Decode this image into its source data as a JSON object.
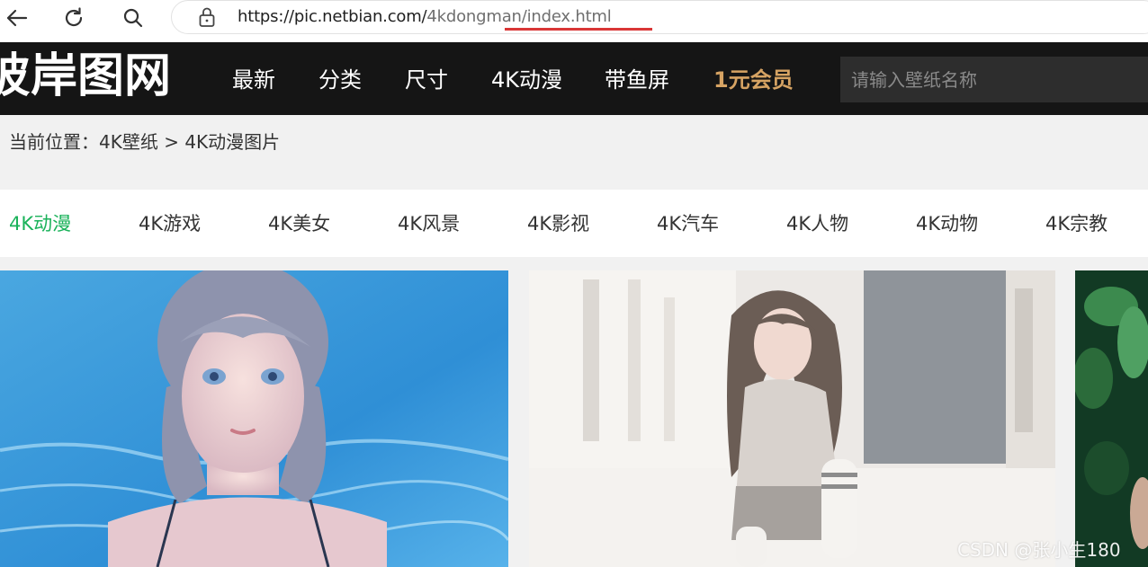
{
  "browser": {
    "url_host": "https://pic.netbian.com/",
    "url_path": "4kdongman/index.html"
  },
  "site": {
    "logo_text": "彼岸图网",
    "nav": [
      "最新",
      "分类",
      "尺寸",
      "4K动漫",
      "带鱼屏",
      "1元会员"
    ],
    "search_placeholder": "请输入壁纸名称"
  },
  "breadcrumb": {
    "prefix": "当前位置：",
    "level1": "4K壁纸",
    "separator": " > ",
    "level2": "4K动漫图片"
  },
  "categories": [
    "4K动漫",
    "4K游戏",
    "4K美女",
    "4K风景",
    "4K影视",
    "4K汽车",
    "4K人物",
    "4K动物",
    "4K宗教"
  ],
  "active_category": "4K动漫",
  "watermark": "CSDN @张小生180",
  "colors": {
    "header_bg": "#151515",
    "vip": "#d6a363",
    "active_category": "#1ab25a",
    "url_underline": "#d93636"
  }
}
